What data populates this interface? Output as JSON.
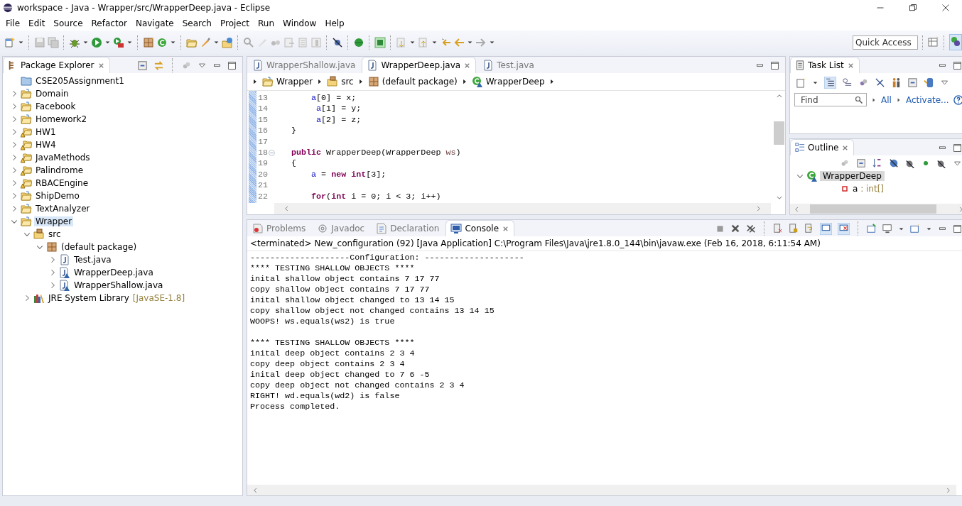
{
  "window": {
    "title": "workspace - Java - Wrapper/src/WrapperDeep.java - Eclipse"
  },
  "menu": [
    "File",
    "Edit",
    "Source",
    "Refactor",
    "Navigate",
    "Search",
    "Project",
    "Run",
    "Window",
    "Help"
  ],
  "quick_access": {
    "placeholder": "Quick Access"
  },
  "package_explorer": {
    "title": "Package Explorer",
    "tree": [
      {
        "label": "CSE205Assignment1",
        "kind": "closed-project",
        "selected": false
      },
      {
        "label": "Domain",
        "kind": "project",
        "expanded": false,
        "selected": false
      },
      {
        "label": "Facebook",
        "kind": "project",
        "expanded": false,
        "selected": false
      },
      {
        "label": "Homework2",
        "kind": "project",
        "expanded": false,
        "selected": false
      },
      {
        "label": "HW1",
        "kind": "warning-project",
        "expanded": false,
        "selected": false
      },
      {
        "label": "HW4",
        "kind": "warning-project",
        "expanded": false,
        "selected": false
      },
      {
        "label": "JavaMethods",
        "kind": "warning-project",
        "expanded": false,
        "selected": false
      },
      {
        "label": "Palindrome",
        "kind": "warning-project",
        "expanded": false,
        "selected": false
      },
      {
        "label": "RBACEngine",
        "kind": "warning-project",
        "expanded": false,
        "selected": false
      },
      {
        "label": "ShipDemo",
        "kind": "project",
        "expanded": false,
        "selected": false
      },
      {
        "label": "TextAnalyzer",
        "kind": "project",
        "expanded": false,
        "selected": false
      },
      {
        "label": "Wrapper",
        "kind": "project",
        "expanded": true,
        "selected": true,
        "children": [
          {
            "label": "src",
            "kind": "source-folder",
            "expanded": true,
            "selected": false,
            "children": [
              {
                "label": "(default package)",
                "kind": "package",
                "expanded": true,
                "selected": false,
                "children": [
                  {
                    "label": "Test.java",
                    "kind": "java-file",
                    "expanded": false,
                    "selected": false
                  },
                  {
                    "label": "WrapperDeep.java",
                    "kind": "java-shared-file",
                    "expanded": false,
                    "selected": false
                  },
                  {
                    "label": "WrapperShallow.java",
                    "kind": "java-shared-file",
                    "expanded": false,
                    "selected": false
                  }
                ]
              }
            ]
          },
          {
            "label": "JRE System Library",
            "decoration": "[JavaSE-1.8]",
            "kind": "library",
            "expanded": false,
            "selected": false
          }
        ]
      }
    ]
  },
  "editor": {
    "tabs": [
      {
        "label": "WrapperShallow.java",
        "selected": false
      },
      {
        "label": "WrapperDeep.java",
        "selected": true
      },
      {
        "label": "Test.java",
        "selected": false
      }
    ],
    "breadcrumb": [
      {
        "label": "Wrapper",
        "kind": "project"
      },
      {
        "label": "src",
        "kind": "source-folder"
      },
      {
        "label": "(default package)",
        "kind": "package"
      },
      {
        "label": "WrapperDeep",
        "kind": "class"
      }
    ],
    "lines": [
      {
        "number": "13",
        "tokens": [
          {
            "kind": "field",
            "text": "    a"
          },
          {
            "kind": "plain",
            "text": "[0] = x;"
          }
        ]
      },
      {
        "number": "14",
        "tokens": [
          {
            "kind": "field",
            "text": "     a"
          },
          {
            "kind": "plain",
            "text": "[1] = y;"
          }
        ]
      },
      {
        "number": "15",
        "tokens": [
          {
            "kind": "field",
            "text": "     a"
          },
          {
            "kind": "plain",
            "text": "[2] = z;"
          }
        ]
      },
      {
        "number": "16",
        "tokens": [
          {
            "kind": "plain",
            "text": "}"
          }
        ]
      },
      {
        "number": "17"
      },
      {
        "number": "18",
        "folded": false,
        "tokens": [
          {
            "kind": "keyword",
            "text": "public"
          },
          {
            "kind": "plain",
            "text": " WrapperDeep(WrapperDeep "
          },
          {
            "kind": "param",
            "text": "ws"
          },
          {
            "kind": "plain",
            "text": ")"
          }
        ]
      },
      {
        "number": "19",
        "tokens": [
          {
            "kind": "plain",
            "text": "{"
          }
        ]
      },
      {
        "number": "20",
        "tokens": [
          {
            "kind": "field",
            "text": "    a"
          },
          {
            "kind": "plain",
            "text": " = "
          },
          {
            "kind": "keyword",
            "text": "new int"
          },
          {
            "kind": "plain",
            "text": "[3];"
          }
        ]
      },
      {
        "number": "21"
      },
      {
        "number": "22",
        "tokens": [
          {
            "kind": "keyword",
            "text": "    for"
          },
          {
            "kind": "plain",
            "text": "("
          },
          {
            "kind": "keyword",
            "text": "int"
          },
          {
            "kind": "plain",
            "text": " i = 0; i < 3; i++)"
          }
        ]
      }
    ]
  },
  "task_list": {
    "title": "Task List",
    "find": {
      "placeholder": "Find"
    },
    "links": [
      "All",
      "Activate..."
    ]
  },
  "outline": {
    "title": "Outline",
    "tree": [
      {
        "label": "WrapperDeep",
        "kind": "class",
        "expanded": true,
        "selected": true,
        "children": [
          {
            "label": "a",
            "type": " : int[]",
            "kind": "private-field",
            "selected": false
          }
        ]
      }
    ]
  },
  "console": {
    "tabs": [
      {
        "label": "Problems",
        "kind": "problems",
        "selected": false
      },
      {
        "label": "Javadoc",
        "kind": "javadoc",
        "selected": false
      },
      {
        "label": "Declaration",
        "kind": "declaration",
        "selected": false
      },
      {
        "label": "Console",
        "kind": "console",
        "selected": true
      }
    ],
    "header": "<terminated> New_configuration (92) [Java Application] C:\\Program Files\\Java\\jre1.8.0_144\\bin\\javaw.exe (Feb 16, 2018, 6:11:54 AM)",
    "blocks": [
      [
        "--------------------Configuration: --------------------",
        "**** TESTING SHALLOW OBJECTS ****",
        "inital shallow object contains 7 17 77",
        "copy shallow object contains 7 17 77",
        "inital shallow object changed to 13 14 15",
        "copy shallow object not changed contains 13 14 15",
        "WOOPS! ws.equals(ws2) is true"
      ],
      [
        "**** TESTING SHALLOW OBJECTS ****",
        "inital deep object contains 2 3 4",
        "copy deep object contains 2 3 4",
        "inital deep object changed to 7 6 -5",
        "copy deep object not changed contains 2 3 4",
        "RIGHT! wd.equals(wd2) is false",
        "Process completed."
      ]
    ]
  }
}
